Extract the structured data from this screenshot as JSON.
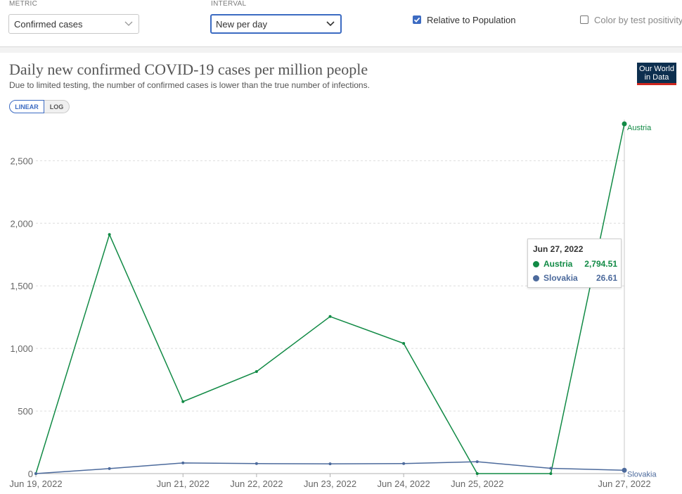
{
  "controls": {
    "metric_label": "METRIC",
    "metric_value": "Confirmed cases",
    "interval_label": "INTERVAL",
    "interval_value": "New per day",
    "relative_label": "Relative to Population",
    "relative_checked": true,
    "positivity_label": "Color by test positivity",
    "positivity_checked": false
  },
  "header": {
    "title": "Daily new confirmed COVID-19 cases per million people",
    "subtitle": "Due to limited testing, the number of confirmed cases is lower than the true number of infections.",
    "logo_line1": "Our World",
    "logo_line2": "in Data"
  },
  "scale_toggle": {
    "linear": "LINEAR",
    "log": "LOG",
    "selected": "LINEAR"
  },
  "colors": {
    "austria": "#118a45",
    "slovakia": "#4c6a9c",
    "accent": "#3c6bc2"
  },
  "chart_data": {
    "type": "line",
    "title": "Daily new confirmed COVID-19 cases per million people",
    "x": [
      "2022-06-19",
      "2022-06-20",
      "2022-06-21",
      "2022-06-22",
      "2022-06-23",
      "2022-06-24",
      "2022-06-25",
      "2022-06-26",
      "2022-06-27"
    ],
    "x_tick_labels": [
      {
        "date": "2022-06-19",
        "label": "Jun 19, 2022"
      },
      {
        "date": "2022-06-21",
        "label": "Jun 21, 2022"
      },
      {
        "date": "2022-06-22",
        "label": "Jun 22, 2022"
      },
      {
        "date": "2022-06-23",
        "label": "Jun 23, 2022"
      },
      {
        "date": "2022-06-24",
        "label": "Jun 24, 2022"
      },
      {
        "date": "2022-06-25",
        "label": "Jun 25, 2022"
      },
      {
        "date": "2022-06-27",
        "label": "Jun 27, 2022"
      }
    ],
    "y_ticks": [
      0,
      500,
      1000,
      1500,
      2000,
      2500
    ],
    "y_tick_labels": [
      "0",
      "500",
      "1,000",
      "1,500",
      "2,000",
      "2,500"
    ],
    "ylim": [
      0,
      2800
    ],
    "grid": true,
    "series": [
      {
        "name": "Austria",
        "values": [
          0,
          1910,
          575,
          815,
          1255,
          1040,
          0,
          0,
          2794.51
        ]
      },
      {
        "name": "Slovakia",
        "values": [
          0,
          40,
          85,
          80,
          78,
          80,
          95,
          42,
          26.61
        ]
      }
    ],
    "tooltip": {
      "date": "Jun 27, 2022",
      "rows": [
        {
          "name": "Austria",
          "value": "2,794.51"
        },
        {
          "name": "Slovakia",
          "value": "26.61"
        }
      ]
    }
  }
}
